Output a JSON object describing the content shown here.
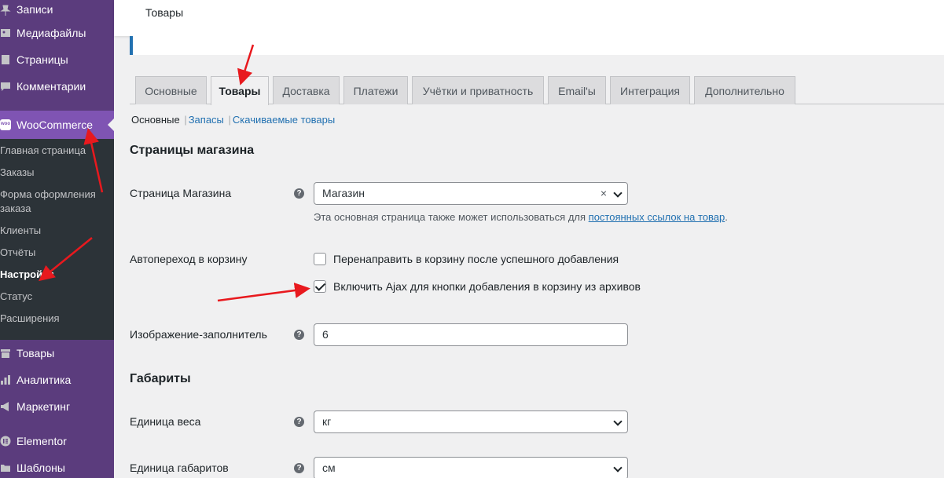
{
  "sidebar": {
    "top_items": [
      {
        "label": "Записи",
        "icon": "pin-icon"
      },
      {
        "label": "Медиафайлы",
        "icon": "media-icon"
      },
      {
        "label": "Страницы",
        "icon": "page-icon"
      },
      {
        "label": "Комментарии",
        "icon": "comment-icon"
      }
    ],
    "woocommerce": "WooCommerce",
    "sub_items": [
      "Главная страница",
      "Заказы",
      "Форма оформления",
      "заказа",
      "Клиенты",
      "Отчёты",
      "Настройки",
      "Статус",
      "Расширения"
    ],
    "bottom_items": [
      {
        "label": "Товары",
        "icon": "archive-icon"
      },
      {
        "label": "Аналитика",
        "icon": "chart-icon"
      },
      {
        "label": "Маркетинг",
        "icon": "megaphone-icon"
      },
      {
        "label": "Elementor",
        "icon": "elementor-icon"
      },
      {
        "label": "Шаблоны",
        "icon": "folder-icon"
      }
    ]
  },
  "header": {
    "title": "Товары"
  },
  "tabs": [
    "Основные",
    "Товары",
    "Доставка",
    "Платежи",
    "Учётки и приватность",
    "Email'ы",
    "Интеграция",
    "Дополнительно"
  ],
  "active_tab": "Товары",
  "subsub": {
    "current": "Основные",
    "link1": "Запасы",
    "link2": "Скачиваемые товары",
    "separator": "|"
  },
  "sections": {
    "shop_pages": "Страницы магазина",
    "dimensions": "Габариты"
  },
  "fields": {
    "shop_page": {
      "label": "Страница Магазина",
      "value": "Магазин",
      "clear": "×",
      "desc_prefix": "Эта основная страница также может использоваться для ",
      "desc_link": "постоянных ссылок на товар",
      "desc_suffix": "."
    },
    "cart_redirect": {
      "label": "Автопереход в корзину",
      "option1": "Перенаправить в корзину после успешного добавления",
      "option1_checked": false,
      "option2": "Включить Ajax для кнопки добавления в корзину из архивов",
      "option2_checked": true
    },
    "placeholder_image": {
      "label": "Изображение-заполнитель",
      "value": "6"
    },
    "weight_unit": {
      "label": "Единица веса",
      "value": "кг"
    },
    "dimension_unit": {
      "label": "Единица габаритов",
      "value": "см"
    }
  },
  "help_glyph": "?",
  "colors": {
    "accent": "#7f54b3",
    "link": "#2271b1",
    "annotation": "#e8191e",
    "sidebar": "#5b3c7d"
  }
}
